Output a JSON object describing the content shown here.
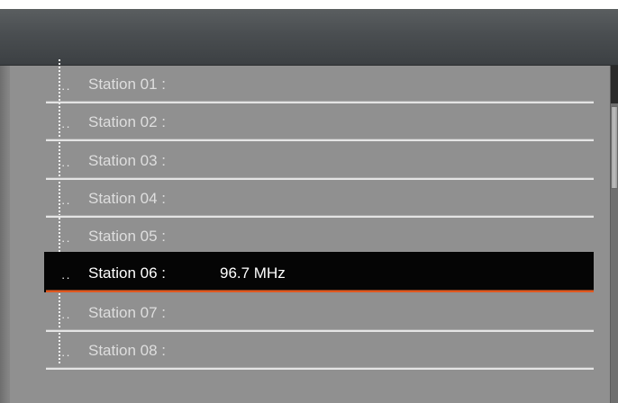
{
  "stations": [
    {
      "label": "Station 01 :",
      "frequency": ""
    },
    {
      "label": "Station 02 :",
      "frequency": ""
    },
    {
      "label": "Station 03 :",
      "frequency": ""
    },
    {
      "label": "Station 04 :",
      "frequency": ""
    },
    {
      "label": "Station 05 :",
      "frequency": ""
    },
    {
      "label": "Station 06 :",
      "frequency": "96.7 MHz"
    },
    {
      "label": "Station 07 :",
      "frequency": ""
    },
    {
      "label": "Station 08 :",
      "frequency": ""
    }
  ],
  "selected_index": 5,
  "colors": {
    "selected_background": "#050505",
    "selected_underline": "#e0581f",
    "panel": "#909090",
    "header": "#4a4e51"
  },
  "icons": {
    "branch": "tree-branch-connector-icon"
  }
}
